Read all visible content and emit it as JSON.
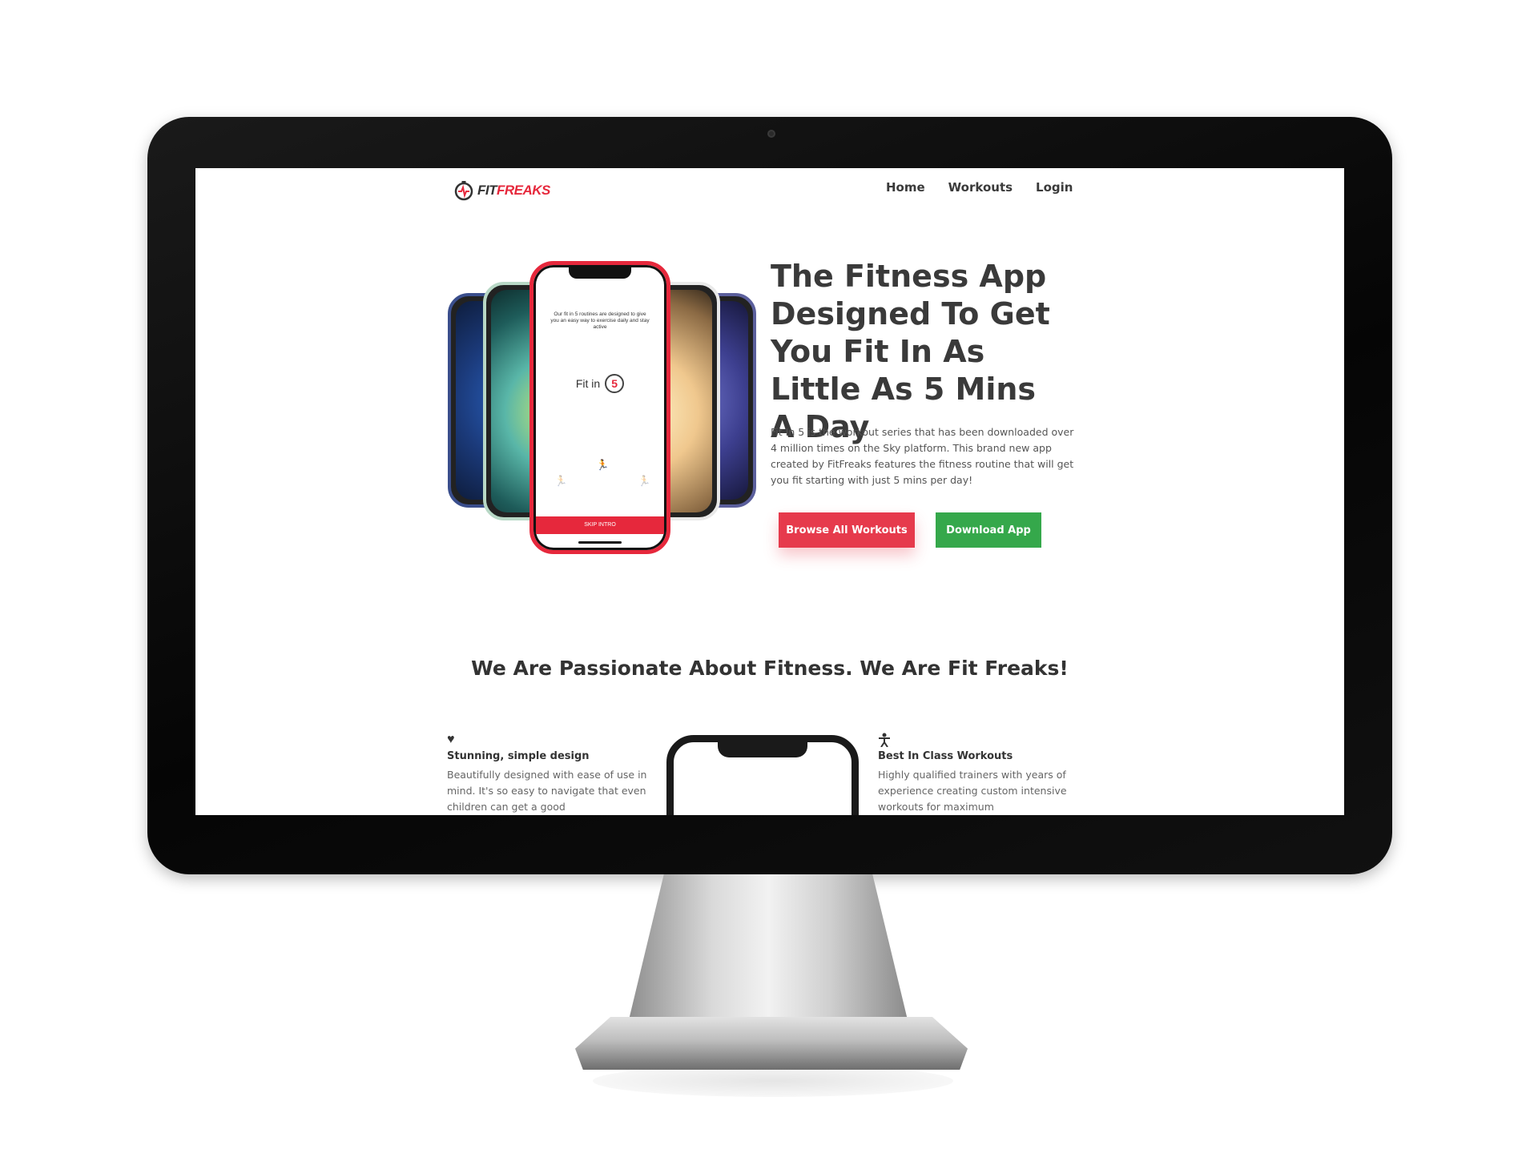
{
  "site": {
    "logo_text_prefix": "FIT",
    "logo_text_suffix": "FREAKS",
    "nav": [
      "Home",
      "Workouts",
      "Login"
    ]
  },
  "hero": {
    "title": "The Fitness App Designed To Get You Fit In As Little As 5 Mins A Day",
    "description": "Fit In 5 is the workout series that has been downloaded over 4 million times on the Sky platform. This brand new app created by FitFreaks features the fitness routine that will get you fit starting with just 5 mins per day!",
    "browse_label": "Browse All Workouts",
    "download_label": "Download App"
  },
  "app_screen": {
    "copy": "Our fit in 5 routines are designed to give you an easy way to exercise daily and stay active",
    "fit_in": "Fit in",
    "five": "5",
    "skip": "SKIP INTRO"
  },
  "section": {
    "title": "We Are Passionate About Fitness. We Are Fit Freaks!"
  },
  "features": [
    {
      "icon": "heart-icon",
      "heading": "Stunning, simple design",
      "body": "Beautifully designed with ease of use in mind. It's so easy to navigate that even children can get a good"
    },
    {
      "icon": "person-icon",
      "heading": "Best In Class Workouts",
      "body": "Highly qualified trainers with years of experience creating custom intensive workouts for maximum"
    }
  ],
  "colors": {
    "brand_red": "#e63a4c",
    "download_green": "#35a84b",
    "text_dark": "#3a3a3a"
  }
}
